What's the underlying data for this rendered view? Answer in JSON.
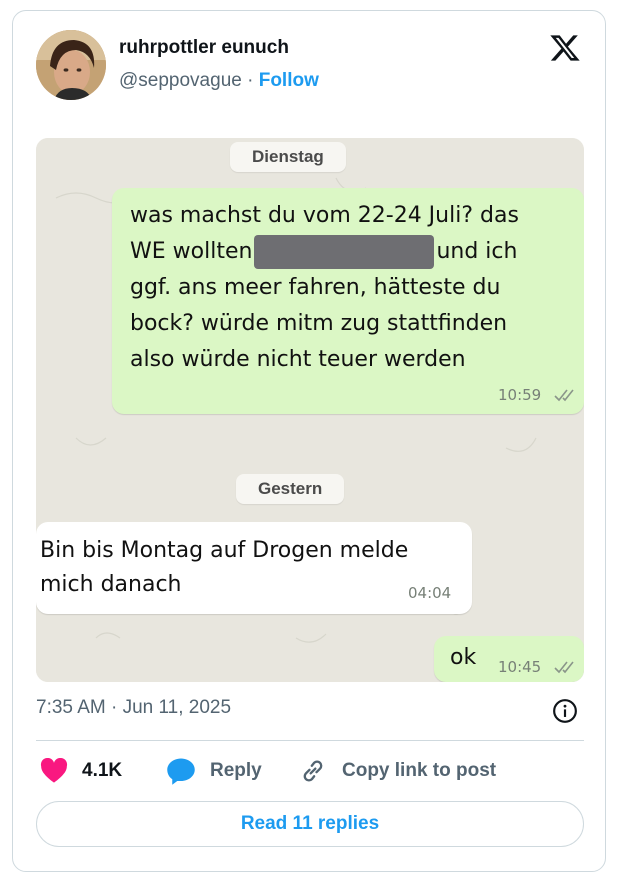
{
  "author": {
    "name": "ruhrpottler eunuch",
    "handle": "@seppovague",
    "separator": "·",
    "follow_label": "Follow"
  },
  "screenshot": {
    "day_labels": [
      "Dienstag",
      "Gestern"
    ],
    "messages": [
      {
        "direction": "outgoing",
        "lines": [
          {
            "before": "was machst du vom 22-24 Juli? das",
            "after": ""
          },
          {
            "before": "WE wollten",
            "redacted": true,
            "after": "und ich"
          },
          {
            "before": "ggf. ans meer fahren, hätteste du",
            "after": ""
          },
          {
            "before": "bock? würde mitm zug stattfinden",
            "after": ""
          },
          {
            "before": "also würde nicht teuer werden",
            "after": ""
          }
        ],
        "time": "10:59",
        "status_icon": "double-check-icon"
      },
      {
        "direction": "incoming",
        "lines": [
          {
            "before": "Bin bis Montag auf Drogen melde",
            "after": ""
          },
          {
            "before": "mich danach",
            "after": ""
          }
        ],
        "time": "04:04"
      },
      {
        "direction": "outgoing",
        "lines": [
          {
            "before": "ok",
            "after": ""
          }
        ],
        "time": "10:45",
        "status_icon": "double-check-icon"
      }
    ]
  },
  "tweet": {
    "time": "7:35 AM",
    "separator": "·",
    "date": "Jun 11, 2025"
  },
  "actions": {
    "likes_count": "4.1K",
    "reply_label": "Reply",
    "copy_link_label": "Copy link to post",
    "read_replies_label": "Read 11 replies"
  },
  "colors": {
    "accent": "#1d9bf0",
    "like": "#f91880",
    "outgoing_bubble": "#dbf7c5",
    "incoming_bubble": "#ffffff"
  }
}
